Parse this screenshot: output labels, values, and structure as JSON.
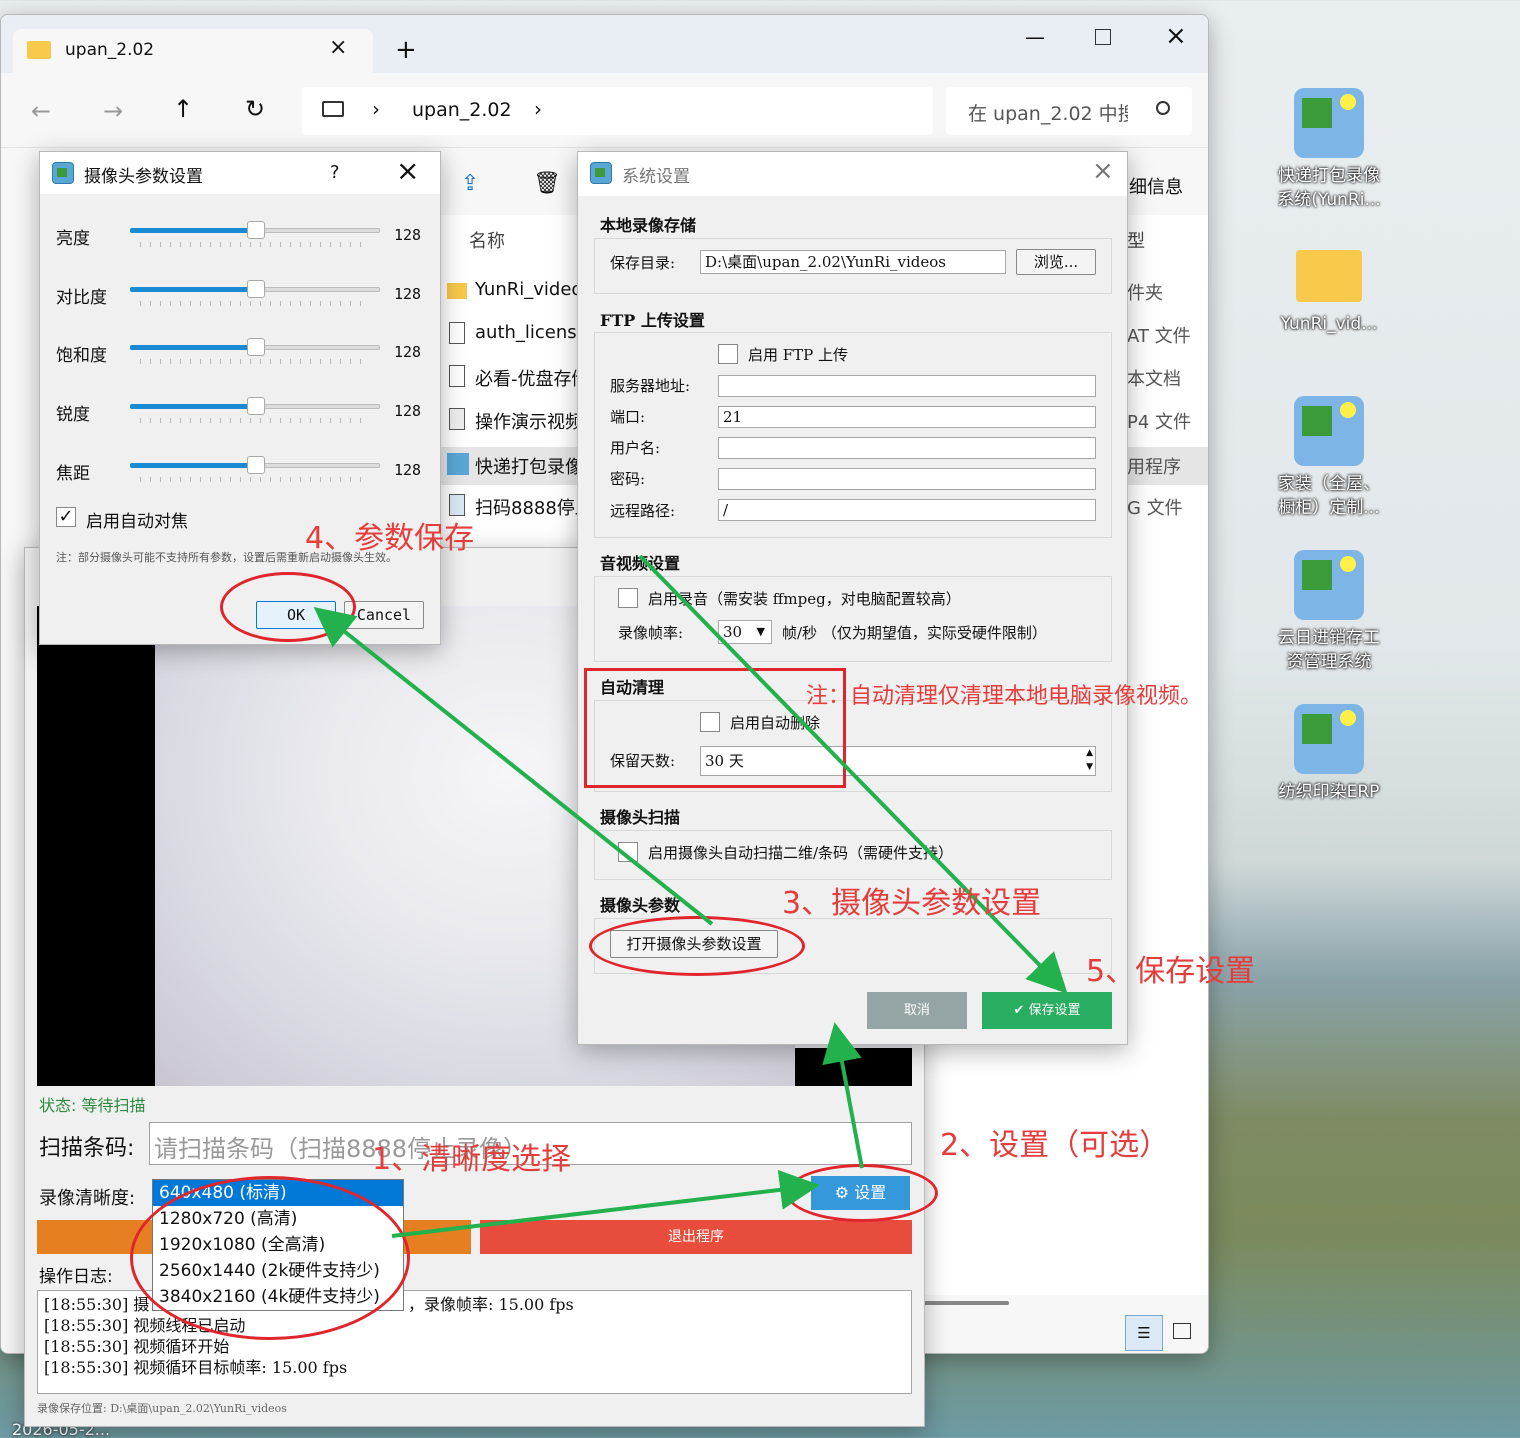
{
  "explorer": {
    "tab_title": "upan_2.02",
    "address": "upan_2.02",
    "search_placeholder": "在 upan_2.02 中搜",
    "details_label": "细信息",
    "column_name": "名称",
    "column_type": "型",
    "files": [
      {
        "name": "YunRi_videos",
        "type": "件夹"
      },
      {
        "name": "auth_license",
        "type": "AT 文件"
      },
      {
        "name": "必看-优盘存储",
        "type": "本文档"
      },
      {
        "name": "操作演示视频",
        "type": "P4 文件"
      },
      {
        "name": "快递打包录像",
        "type": "用程序"
      },
      {
        "name": "扫码8888停止",
        "type": "G 文件"
      }
    ]
  },
  "camera_dialog": {
    "title": "摄像头参数设置",
    "help": "?",
    "sliders": [
      {
        "label": "亮度",
        "value": "128",
        "fraction": 0.5
      },
      {
        "label": "对比度",
        "value": "128",
        "fraction": 0.5
      },
      {
        "label": "饱和度",
        "value": "128",
        "fraction": 0.5
      },
      {
        "label": "锐度",
        "value": "128",
        "fraction": 0.5
      },
      {
        "label": "焦距",
        "value": "128",
        "fraction": 0.5
      }
    ],
    "autofocus_label": "启用自动对焦",
    "autofocus_checked": true,
    "note": "注：部分摄像头可能不支持所有参数，设置后需重新启动摄像头生效。",
    "ok": "OK",
    "cancel": "Cancel"
  },
  "settings_dialog": {
    "title": "系统设置",
    "local_section": "本地录像存储",
    "save_dir_label": "保存目录:",
    "save_dir_value": "D:\\桌面\\upan_2.02\\YunRi_videos",
    "browse": "浏览...",
    "ftp_section": "FTP 上传设置",
    "ftp_enable": "启用 FTP 上传",
    "server_label": "服务器地址:",
    "port_label": "端口:",
    "port_value": "21",
    "user_label": "用户名:",
    "password_label": "密码:",
    "remote_label": "远程路径:",
    "remote_value": "/",
    "av_section": "音视频设置",
    "audio_enable": "启用录音（需安装 ffmpeg，对电脑配置较高）",
    "fps_label": "录像帧率:",
    "fps_value": "30",
    "fps_unit": "帧/秒 （仅为期望值，实际受硬件限制）",
    "clean_section": "自动清理",
    "clean_enable": "启用自动删除",
    "keep_days_label": "保留天数:",
    "keep_days_value": "30 天",
    "scan_section": "摄像头扫描",
    "scan_enable": "启用摄像头自动扫描二维/条码（需硬件支持）",
    "camparam_section": "摄像头参数",
    "open_camparam": "打开摄像头参数设置",
    "cancel": "取消",
    "save": "保存设置"
  },
  "main_app": {
    "status": "状态: 等待扫描",
    "scan_label": "扫描条码:",
    "scan_placeholder": "请扫描条码（扫描8888停止录像）",
    "clarity_label": "录像清晰度:",
    "clarity_options": [
      "640x480 (标清)",
      "1280x720 (高清)",
      "1920x1080 (全高清)",
      "2560x1440 (2k硬件支持少)",
      "3840x2160 (4k硬件支持少)"
    ],
    "settings_btn": "设置",
    "exit_btn": "退出程序",
    "log_label": "操作日志:",
    "log_lines": [
      "[18:55:30] 摄",
      "[18:55:30] 视频线程已启动",
      "[18:55:30] 视频循环开始",
      "[18:55:30] 视频循环目标帧率: 15.00 fps"
    ],
    "log_fps_tail": "，录像帧率: 15.00 fps",
    "save_path": "录像保存位置: D:\\桌面\\upan_2.02\\YunRi_videos"
  },
  "annotations": {
    "a1": "1、清晰度选择",
    "a2": "2、设置（可选）",
    "a3": "3、摄像头参数设置",
    "a4": "4、参数保存",
    "a5": "5、保存设置",
    "note": "注：自动清理仅清理本地电脑录像视频。"
  },
  "desktop": {
    "icons": [
      "快递打包录像系统(YunRi...",
      "YunRi_vid...",
      "家装（全屋、橱柜）定制...",
      "云日进销存工资管理系统",
      "纺织印染ERP"
    ],
    "clock": "2026-05-2..."
  },
  "colors": {
    "accent": "#0078d7",
    "green": "#27ae60",
    "red": "#e74c3c",
    "orange": "#e67e22",
    "annotation": "#e53c3c"
  }
}
